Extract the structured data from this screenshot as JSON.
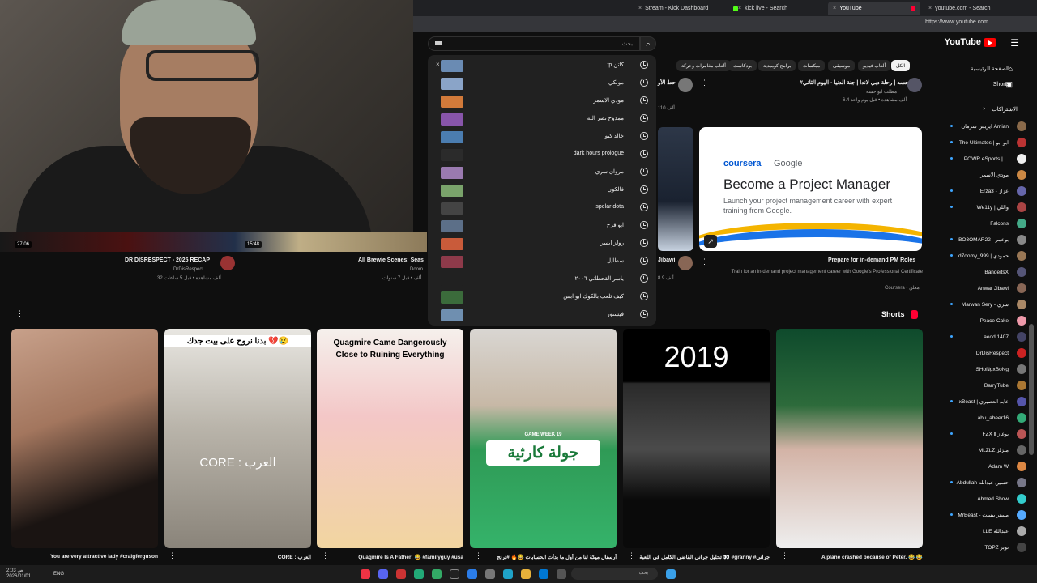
{
  "browser": {
    "tabs": [
      {
        "label": "Stream - Kick Dashboard"
      },
      {
        "label": "kick live - Search"
      },
      {
        "label": "YouTube"
      },
      {
        "label": "youtube.com - Search"
      }
    ],
    "url": "https://www.youtube.com"
  },
  "youtube": {
    "logo_text": "YouTube",
    "search_placeholder": "بحث",
    "search_icon": "search-icon",
    "home_label": "الصفحة الرئيسية",
    "shorts_nav": "Shorts",
    "subscriptions_label": "الاشتراكات",
    "shorts_section": "Shorts"
  },
  "suggestions": [
    {
      "text": "fp كاتن",
      "color": "#6a8bb3"
    },
    {
      "text": "مونكي",
      "color": "#8aa4c8"
    },
    {
      "text": "مودي الاسمر",
      "color": "#d27a3a"
    },
    {
      "text": "ممدوح نصر الله",
      "color": "#8855aa"
    },
    {
      "text": "خالد كبو",
      "color": "#4b7db0"
    },
    {
      "text": "dark hours prologue",
      "color": "#2b2b2b"
    },
    {
      "text": "مروان سري",
      "color": "#9a7ab0"
    },
    {
      "text": "فالكون",
      "color": "#7aa36b"
    },
    {
      "text": "spelar dota",
      "color": "#444444"
    },
    {
      "text": "ابو فرح",
      "color": "#5c6f88"
    },
    {
      "text": "رولز ايسر",
      "color": "#c95b3a"
    },
    {
      "text": "سطايل",
      "color": "#8e3a4a"
    },
    {
      "text": "ياسر القحطاني ٢٠٠٦",
      "color": "#212121"
    },
    {
      "text": "كيف تلعب بالكوك ابو ابس",
      "color": "#3b6b3b"
    },
    {
      "text": "فيستور",
      "color": "#6f8fb0"
    }
  ],
  "chips": [
    {
      "label": "الكل",
      "active": true
    },
    {
      "label": "ألعاب فيديو",
      "active": false
    },
    {
      "label": "موسيقى",
      "active": false
    },
    {
      "label": "ميكسات",
      "active": false
    },
    {
      "label": "برامج كوميدية",
      "active": false
    },
    {
      "label": "بودكاست",
      "active": false
    },
    {
      "label": "ألعاب مغامرات وحركة",
      "active": false
    }
  ],
  "top_videos": [
    {
      "title": "#ابوحسه | رحلة دبي لاندا | جنة الدنيا - اليوم الثاني",
      "channel": "مطلب ابو حسه",
      "meta": "6.4 ألف مشاهدة • قبل يوم واحد"
    },
    {
      "title": "حط الأو",
      "channel": "",
      "meta": "110 ألف"
    }
  ],
  "ad": {
    "brand": "coursera",
    "brand2": "Google",
    "headline": "Become a Project Manager",
    "sub": "Launch your project management career with expert training from Google.",
    "title": "Prepare for in-demand PM Roles",
    "desc": "Train for an in-demand project management career with Google's Professional Certificate",
    "sponsor": "Coursera • معلن"
  },
  "row_videos": [
    {
      "title": "DR DISRESPECT - 2025 RECAP",
      "channel": "DrDisRespect",
      "meta": "32 ألف مشاهدة • قبل 5 ساعات",
      "duration": "27:06"
    },
    {
      "title": "All Brewie Scenes: Seas",
      "channel": "Doom",
      "meta": "ألف • قبل 7 سنوات",
      "duration": "15:48"
    },
    {
      "title": "Jibawi",
      "channel": "",
      "meta": "8.9 ألف"
    }
  ],
  "sidebar": [
    {
      "label": "ايريس سرمان Amian",
      "color": "#8a6a4a",
      "dot": true
    },
    {
      "label": "The Ultimates | ابو ابو",
      "color": "#b33",
      "dot": true
    },
    {
      "label": "POWR eSports | ...",
      "color": "#eee",
      "dot": true
    },
    {
      "label": "مودي الاسمر",
      "color": "#c84",
      "dot": false
    },
    {
      "label": "Erza3 - عزاز",
      "color": "#66a",
      "dot": true
    },
    {
      "label": "We11y | واللي",
      "color": "#a44",
      "dot": true
    },
    {
      "label": "Falcons",
      "color": "#4a8",
      "dot": false
    },
    {
      "label": "BO3OMAR22 - بوعمر",
      "color": "#888",
      "dot": true
    },
    {
      "label": "d7oomy_999 | حمودي",
      "color": "#975",
      "dot": true
    },
    {
      "label": "BandeitsX",
      "color": "#557",
      "dot": false
    },
    {
      "label": "Anwar Jibawi",
      "color": "#865",
      "dot": false
    },
    {
      "label": "Marwan Sery - سري",
      "color": "#a86",
      "dot": true
    },
    {
      "label": "Peace Cake",
      "color": "#e9a",
      "dot": false
    },
    {
      "label": "aeod 1407",
      "color": "#446",
      "dot": true
    },
    {
      "label": "DrDisRespect",
      "color": "#c22",
      "dot": false
    },
    {
      "label": "SHoNgxBoNg",
      "color": "#777",
      "dot": false
    },
    {
      "label": "BarryTube",
      "color": "#a73",
      "dot": false
    },
    {
      "label": "xBeast | عابد العصيري",
      "color": "#55a",
      "dot": true
    },
    {
      "label": "abu_abeer16",
      "color": "#3a7",
      "dot": false
    },
    {
      "label": "FZX ll بوغاز",
      "color": "#b55",
      "dot": true
    },
    {
      "label": "MLZLZ ملزلز",
      "color": "#666",
      "dot": false
    },
    {
      "label": "Adam W",
      "color": "#d84",
      "dot": false
    },
    {
      "label": "Abdullah حسين عبدالله",
      "color": "#778",
      "dot": true
    },
    {
      "label": "Ahmed Show",
      "color": "#3cc",
      "dot": false
    },
    {
      "label": "MrBeast - مستر بيست",
      "color": "#5af",
      "dot": true
    },
    {
      "label": "LLE عبدالله",
      "color": "#aaa",
      "dot": false
    },
    {
      "label": "TOPZ توبز",
      "color": "#444",
      "dot": false
    }
  ],
  "shorts": [
    {
      "caption": "You are very attractive lady #craigferguson",
      "overlay": ""
    },
    {
      "caption": "CORE : العرب",
      "overlay": "بدنا نروح على بيت جدك 💔😢",
      "overlay2": "CORE : العرب"
    },
    {
      "caption": "Quagmire Is A Father! 😂 #familyguy #usa",
      "overlay": "Quagmire Came Dangerously Close to Ruining Everything"
    },
    {
      "caption": "أرسنال ميكة لنا من أول ما بدأت الحسابات 😂🔥 #ترنج",
      "overlay": "جولة كارثية",
      "overlay_small": "GAME WEEK 19"
    },
    {
      "caption": "تحليل جراني القاضي الكامل في اللعبة 👀 #granny #جراني",
      "overlay": "2019"
    },
    {
      "caption": "A plane crashed because of Peter. 😂 😂",
      "overlay": ""
    }
  ],
  "taskbar": {
    "search": "بحث",
    "lang": "ENG",
    "clock": "2:03 ص",
    "date": "2026/01/01"
  }
}
